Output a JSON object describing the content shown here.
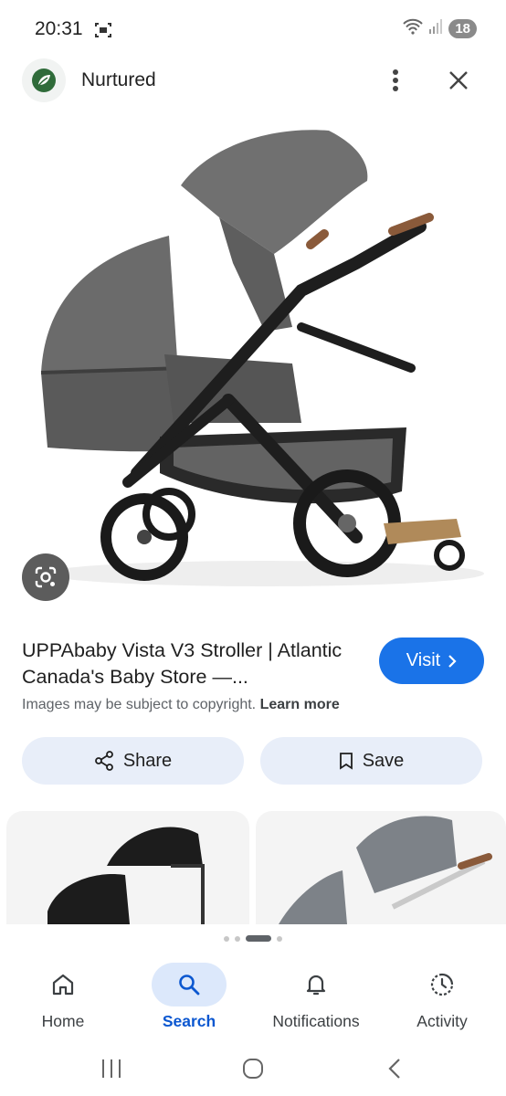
{
  "status_bar": {
    "time": "20:31",
    "battery": "18"
  },
  "header": {
    "site_name": "Nurtured"
  },
  "result": {
    "title": "UPPAbaby Vista V3 Stroller | Atlantic Canada's Baby Store —...",
    "visit_label": "Visit",
    "copyright_text": "Images may be subject to copyright.",
    "learn_more": "Learn more"
  },
  "actions": {
    "share_label": "Share",
    "save_label": "Save"
  },
  "carousel": {
    "pages": 4,
    "active_index": 2
  },
  "bottom_nav": {
    "items": [
      {
        "label": "Home",
        "icon": "home-icon"
      },
      {
        "label": "Search",
        "icon": "search-icon",
        "active": true
      },
      {
        "label": "Notifications",
        "icon": "bell-icon"
      },
      {
        "label": "Activity",
        "icon": "activity-icon"
      }
    ]
  },
  "colors": {
    "accent": "#1a73e8",
    "action_bg": "#e8eef9",
    "active_nav_bg": "#dce8fb"
  }
}
